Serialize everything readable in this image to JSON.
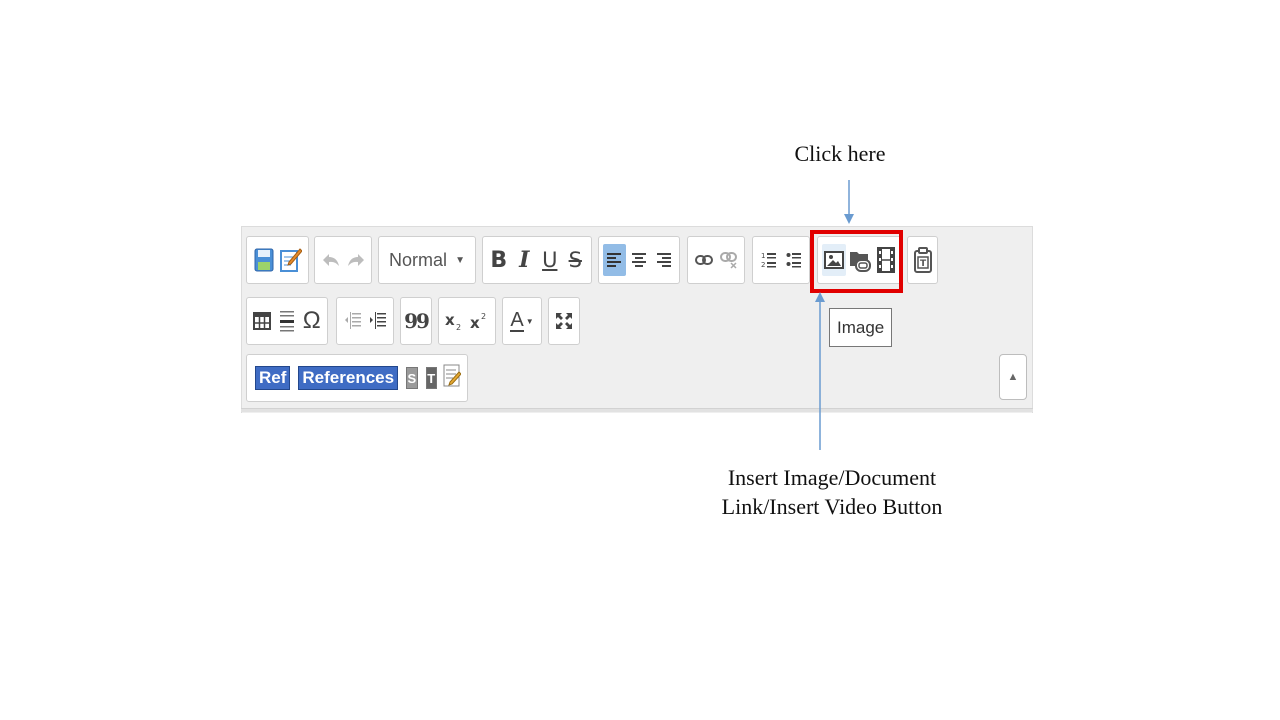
{
  "annotations": {
    "top": "Click here",
    "bottom_line1": "Insert Image/Document",
    "bottom_line2": "Link/Insert Video Button",
    "arrow_color": "#6a9bd0",
    "highlight_color": "#e10000"
  },
  "toolbar": {
    "format_select": {
      "value": "Normal"
    },
    "bold": "B",
    "italic": "I",
    "underline": "U",
    "strike": "S",
    "special_char": "Ω",
    "blockquote": "99",
    "text_color": "A",
    "ref_label": "Ref",
    "references_label": "References",
    "s_tag": "S",
    "t_tag": "T"
  },
  "tooltip": {
    "text": "Image"
  },
  "icons": {
    "save": "save-icon",
    "edit": "edit-icon",
    "undo": "undo-icon",
    "redo": "redo-icon",
    "image": "image-icon",
    "document_link": "document-link-icon",
    "video": "video-icon",
    "paste_text": "paste-text-icon",
    "maximize": "maximize-icon"
  }
}
